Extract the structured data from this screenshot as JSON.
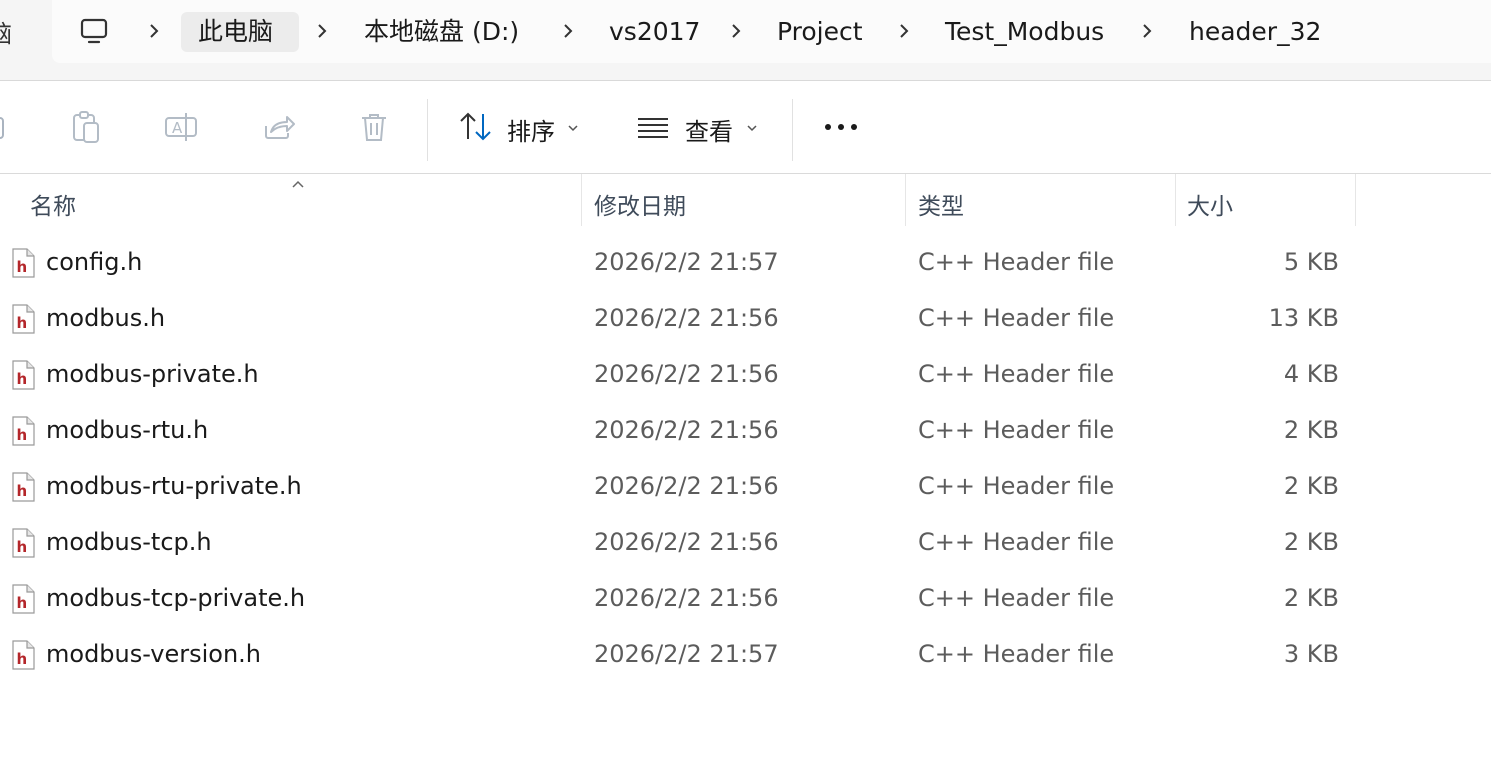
{
  "address": {
    "left_glyph": "脑",
    "icon": "monitor-icon",
    "breadcrumbs": [
      "此电脑",
      "本地磁盘 (D:)",
      "vs2017",
      "Project",
      "Test_Modbus",
      "header_32"
    ]
  },
  "commands": {
    "sort_label": "排序",
    "view_label": "查看",
    "icons": [
      "copy-icon",
      "paste-icon",
      "rename-icon",
      "share-icon",
      "delete-icon",
      "sort-icon",
      "view-icon",
      "more-icon"
    ]
  },
  "columns": {
    "name": "名称",
    "date": "修改日期",
    "type": "类型",
    "size": "大小"
  },
  "files": [
    {
      "name": "config.h",
      "date": "2026/2/2 21:57",
      "type": "C++ Header file",
      "size": "5 KB"
    },
    {
      "name": "modbus.h",
      "date": "2026/2/2 21:56",
      "type": "C++ Header file",
      "size": "13 KB"
    },
    {
      "name": "modbus-private.h",
      "date": "2026/2/2 21:56",
      "type": "C++ Header file",
      "size": "4 KB"
    },
    {
      "name": "modbus-rtu.h",
      "date": "2026/2/2 21:56",
      "type": "C++ Header file",
      "size": "2 KB"
    },
    {
      "name": "modbus-rtu-private.h",
      "date": "2026/2/2 21:56",
      "type": "C++ Header file",
      "size": "2 KB"
    },
    {
      "name": "modbus-tcp.h",
      "date": "2026/2/2 21:56",
      "type": "C++ Header file",
      "size": "2 KB"
    },
    {
      "name": "modbus-tcp-private.h",
      "date": "2026/2/2 21:56",
      "type": "C++ Header file",
      "size": "2 KB"
    },
    {
      "name": "modbus-version.h",
      "date": "2026/2/2 21:57",
      "type": "C++ Header file",
      "size": "3 KB"
    }
  ],
  "colors": {
    "accent": "#0067c0",
    "file_icon": "#b4262a"
  }
}
